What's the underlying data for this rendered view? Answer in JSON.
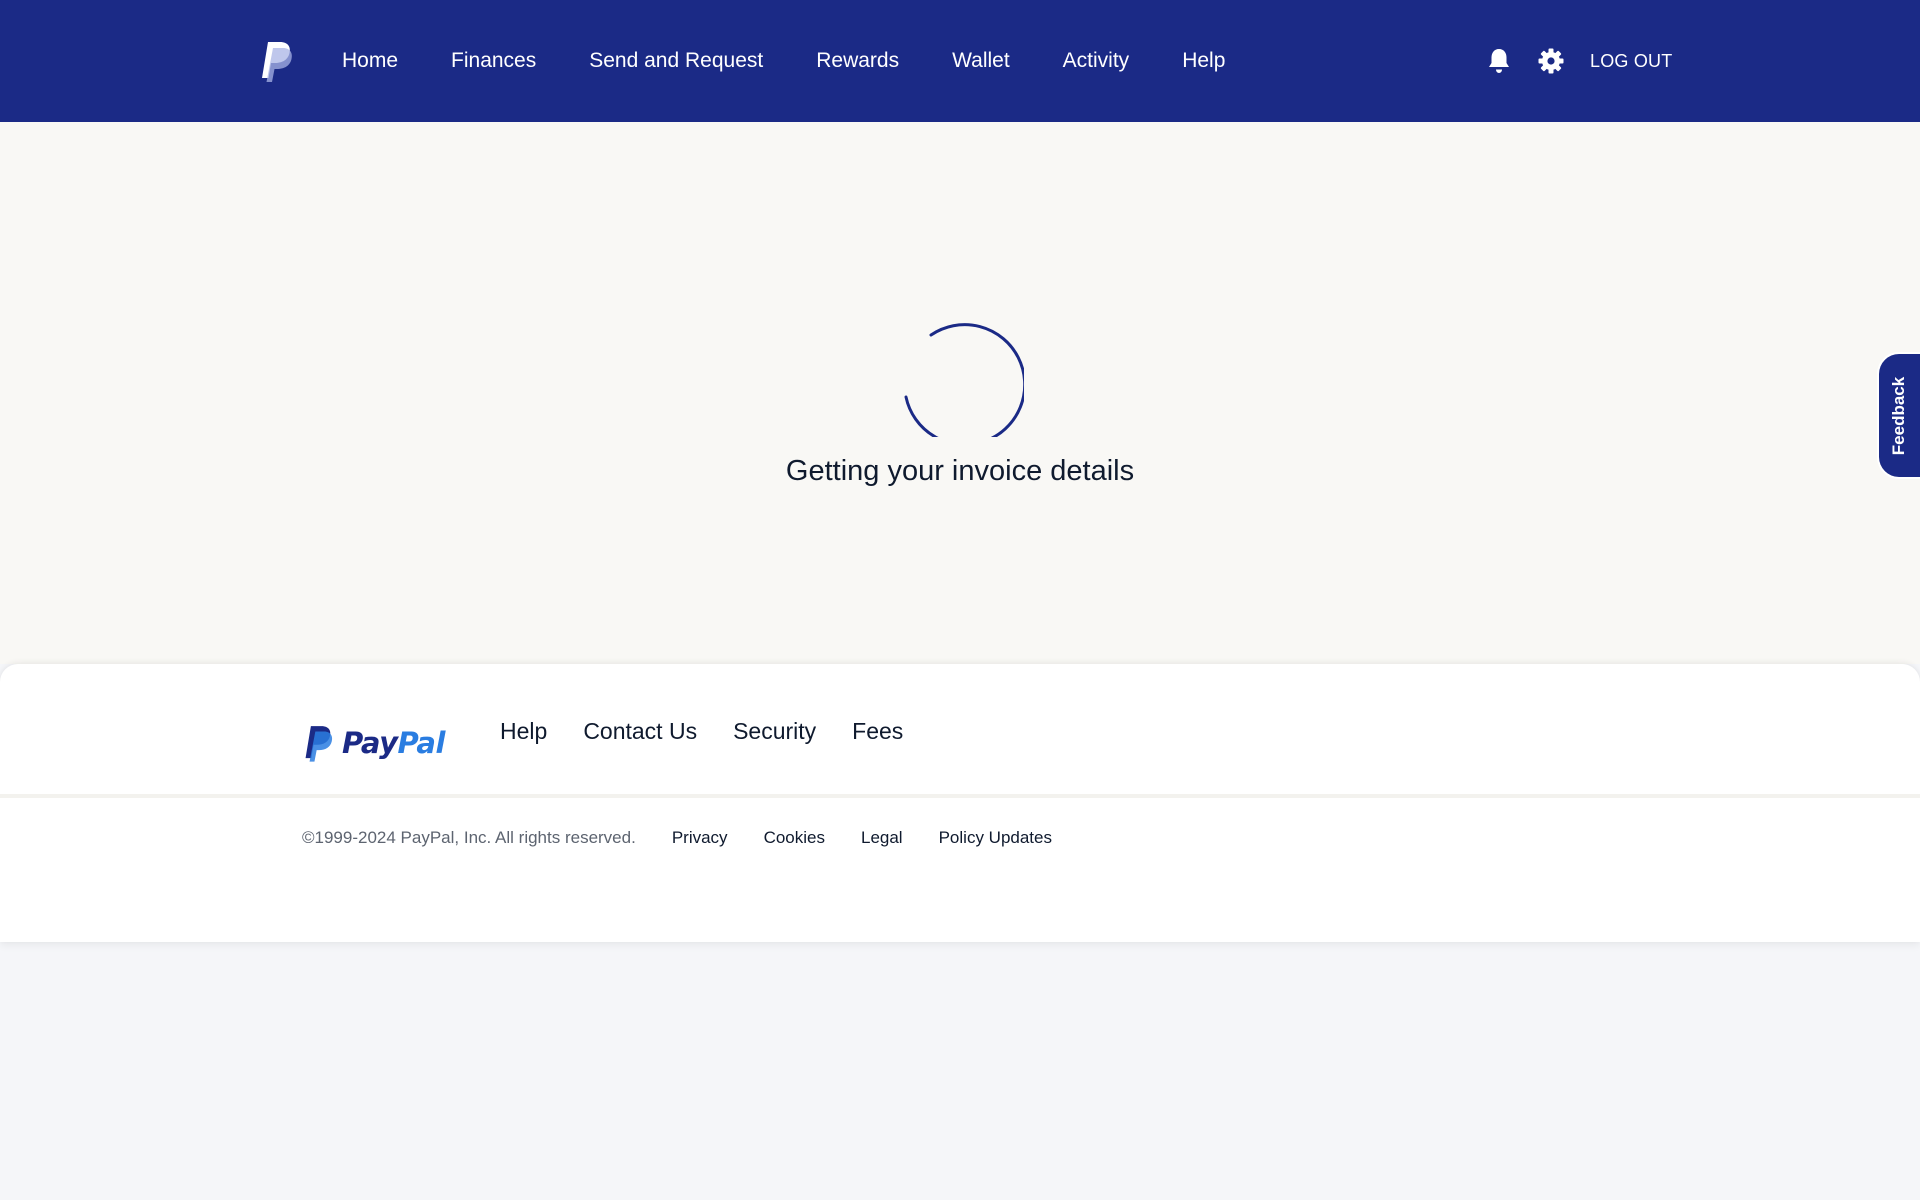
{
  "header": {
    "nav": [
      "Home",
      "Finances",
      "Send and Request",
      "Rewards",
      "Wallet",
      "Activity",
      "Help"
    ],
    "logout_label": "LOG OUT",
    "icons": {
      "logo": "paypal-p-icon",
      "notifications": "bell-icon",
      "settings": "gear-icon"
    }
  },
  "main": {
    "loading_text": "Getting your invoice details"
  },
  "feedback": {
    "label": "Feedback"
  },
  "footer": {
    "brand": {
      "pay": "Pay",
      "pal": "Pal"
    },
    "links": [
      "Help",
      "Contact Us",
      "Security",
      "Fees"
    ],
    "copyright": "©1999-2024 PayPal, Inc. All rights reserved.",
    "legal_links": [
      "Privacy",
      "Cookies",
      "Legal",
      "Policy Updates"
    ]
  },
  "colors": {
    "header_bg": "#1b2a86",
    "brand_dark": "#1b2a86",
    "brand_light": "#2a7de1",
    "page_bg": "#f9f8f5"
  }
}
